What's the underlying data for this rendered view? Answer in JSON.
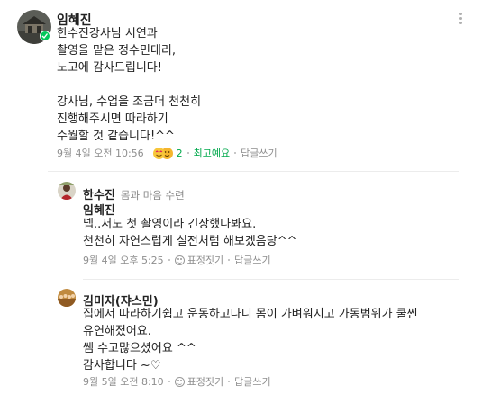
{
  "comments": [
    {
      "author": "임혜진",
      "lines": [
        "한수진강사님 시연과",
        "촬영을 맡은 정수민대리,",
        "노고에 감사드립니다!",
        "",
        "강사님, 수업을 조금더 천천히",
        "진행해주시면 따라하기",
        "수월할 것 같습니다!^^"
      ],
      "date": "9월 4일 오전 10:56",
      "reaction_count": "2",
      "best_label": "최고예요",
      "reply_label": "답글쓰기",
      "avatar_icon": "cafe-manager-avatar",
      "badge_icon": "staff-badge-icon"
    },
    {
      "author": "한수진",
      "author_sub": "몸과 마음 수련",
      "mention": "임혜진",
      "lines": [
        "넵..저도 첫 촬영이라 긴장했나봐요.",
        "천천히 자연스럽게  실전처럼 해보겠음당^^"
      ],
      "date": "9월 4일 오후 5:25",
      "reaction_label": "표정짓기",
      "reply_label": "답글쓰기",
      "avatar_icon": "profile-photo-avatar"
    },
    {
      "author": "김미자(쟈스민)",
      "lines": [
        "집에서 따라하기쉽고 운동하고나니 몸이 가벼워지고 가동범위가 쿨씬",
        "유연해졌어요.",
        "쌤 수고많으셨어요 ^^",
        "감사합니다 ~♡"
      ],
      "date": "9월 5일 오전 8:10",
      "reaction_label": "표정짓기",
      "reply_label": "답글쓰기",
      "avatar_icon": "group-photo-avatar"
    }
  ],
  "colors": {
    "best": "#03a94d",
    "meta": "#8e8e8e",
    "badge": "#03c75a"
  }
}
